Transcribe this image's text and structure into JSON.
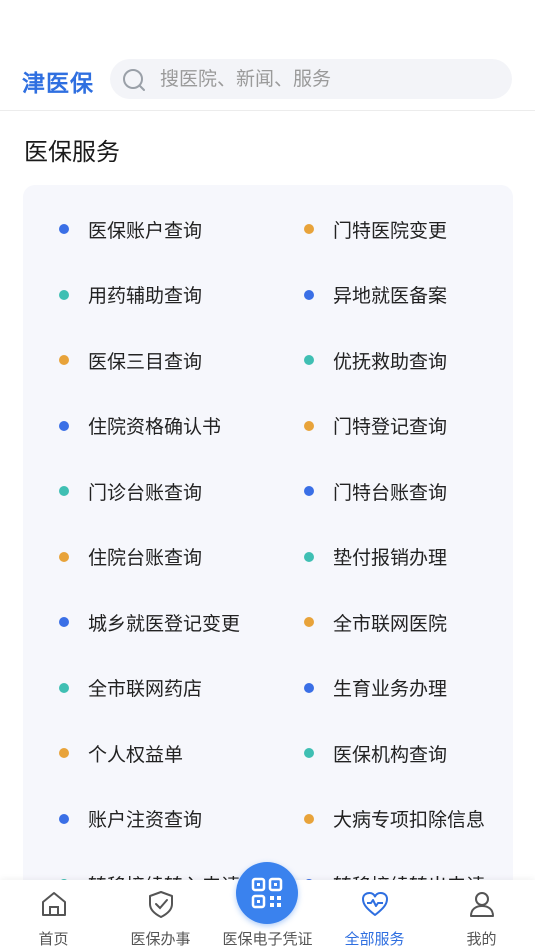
{
  "header": {
    "logo": "津医保",
    "search_placeholder": "搜医院、新闻、服务"
  },
  "section": {
    "title": "医保服务"
  },
  "services": [
    {
      "label": "医保账户查询",
      "color": "blue"
    },
    {
      "label": "门特医院变更",
      "color": "orange"
    },
    {
      "label": "用药辅助查询",
      "color": "teal"
    },
    {
      "label": "异地就医备案",
      "color": "blue"
    },
    {
      "label": "医保三目查询",
      "color": "orange"
    },
    {
      "label": "优抚救助查询",
      "color": "teal"
    },
    {
      "label": "住院资格确认书",
      "color": "blue"
    },
    {
      "label": "门特登记查询",
      "color": "orange"
    },
    {
      "label": "门诊台账查询",
      "color": "teal"
    },
    {
      "label": "门特台账查询",
      "color": "blue"
    },
    {
      "label": "住院台账查询",
      "color": "orange"
    },
    {
      "label": "垫付报销办理",
      "color": "teal"
    },
    {
      "label": "城乡就医登记变更",
      "color": "blue"
    },
    {
      "label": "全市联网医院",
      "color": "orange"
    },
    {
      "label": "全市联网药店",
      "color": "teal"
    },
    {
      "label": "生育业务办理",
      "color": "blue"
    },
    {
      "label": "个人权益单",
      "color": "orange"
    },
    {
      "label": "医保机构查询",
      "color": "teal"
    },
    {
      "label": "账户注资查询",
      "color": "blue"
    },
    {
      "label": "大病专项扣除信息",
      "color": "orange"
    },
    {
      "label": "转移接续转入申请",
      "color": "teal"
    },
    {
      "label": "转移接续转出申请",
      "color": "blue"
    }
  ],
  "colors": {
    "blue": "#3a6fe6",
    "orange": "#e8a33a",
    "teal": "#3fbfb3",
    "accent": "#2f6fe0"
  },
  "tabbar": {
    "tabs": [
      {
        "label": "首页",
        "icon": "home-icon",
        "active": false
      },
      {
        "label": "医保办事",
        "icon": "shield-check-icon",
        "active": false
      },
      {
        "label": "医保电子凭证",
        "icon": "qr-code-icon",
        "active": false
      },
      {
        "label": "全部服务",
        "icon": "heart-pulse-icon",
        "active": true
      },
      {
        "label": "我的",
        "icon": "user-icon",
        "active": false
      }
    ]
  }
}
